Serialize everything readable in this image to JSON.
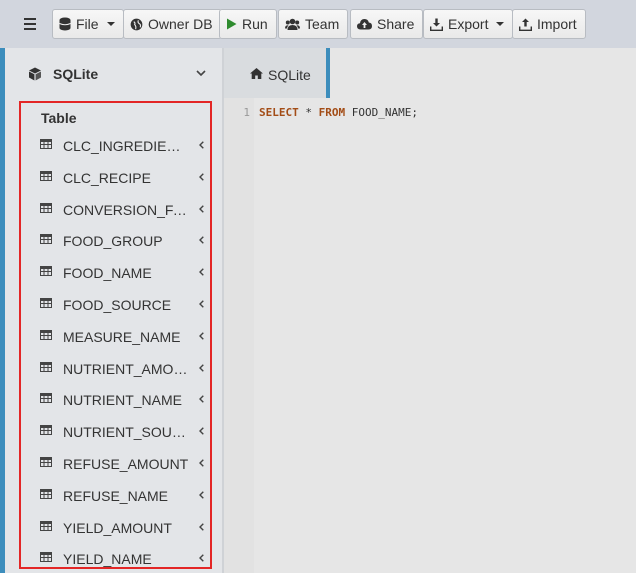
{
  "toolbar": {
    "buttons": {
      "file": "File",
      "owner_db": "Owner DB",
      "run": "Run",
      "team": "Team",
      "share": "Share",
      "export": "Export",
      "import": "Import"
    }
  },
  "sidebar": {
    "database_name": "SQLite",
    "section_label": "Table",
    "tables": [
      "CLC_INGREDIENTS",
      "CLC_RECIPE",
      "CONVERSION_FA...",
      "FOOD_GROUP",
      "FOOD_NAME",
      "FOOD_SOURCE",
      "MEASURE_NAME",
      "NUTRIENT_AMOUNT",
      "NUTRIENT_NAME",
      "NUTRIENT_SOURCE",
      "REFUSE_AMOUNT",
      "REFUSE_NAME",
      "YIELD_AMOUNT",
      "YIELD_NAME"
    ]
  },
  "editor": {
    "tab_label": "SQLite",
    "line_number": "1",
    "query": {
      "kw_select": "SELECT",
      "star": " * ",
      "kw_from": "FROM",
      "rest": " FOOD_NAME;"
    }
  },
  "colors": {
    "accent": "#3c8dbc",
    "highlight_border": "#e32626",
    "sql_keyword": "#a34d17",
    "run_icon": "#2e8b2e"
  }
}
